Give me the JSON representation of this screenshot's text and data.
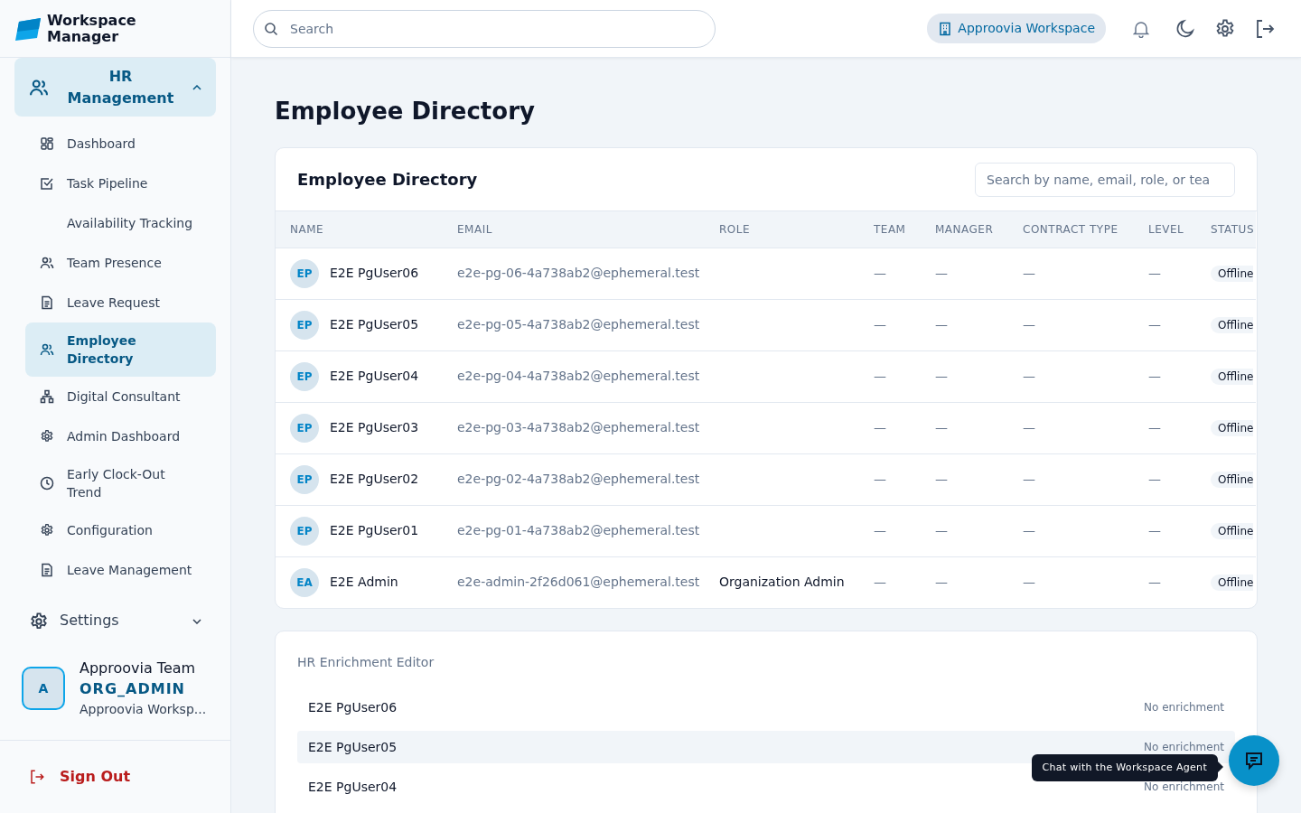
{
  "app": {
    "title": "Workspace Manager"
  },
  "header": {
    "search_placeholder": "Search",
    "workspace": "Approovia Workspace"
  },
  "sidebar": {
    "groups": [
      {
        "label": "HR Management",
        "expanded": true,
        "items": [
          {
            "label": "Dashboard",
            "selected": false
          },
          {
            "label": "Task Pipeline",
            "selected": false
          },
          {
            "label": "Availability Tracking",
            "selected": false
          },
          {
            "label": "Team Presence",
            "selected": false
          },
          {
            "label": "Leave Request",
            "selected": false
          },
          {
            "label": "Employee Directory",
            "selected": true
          },
          {
            "label": "Digital Consultant",
            "selected": false
          },
          {
            "label": "Admin Dashboard",
            "selected": false
          },
          {
            "label": "Early Clock-Out Trend",
            "selected": false
          },
          {
            "label": "Configuration",
            "selected": false
          },
          {
            "label": "Leave Management",
            "selected": false
          }
        ]
      },
      {
        "label": "Settings",
        "expanded": false
      }
    ],
    "user": {
      "initial": "A",
      "name": "Approovia Team",
      "role": "ORG_ADMIN",
      "workspace": "Approovia Worksp..."
    },
    "sign_out": "Sign Out"
  },
  "page": {
    "title": "Employee Directory"
  },
  "directory": {
    "title": "Employee Directory",
    "search_placeholder": "Search by name, email, role, or tea",
    "columns": [
      "NAME",
      "EMAIL",
      "ROLE",
      "TEAM",
      "MANAGER",
      "CONTRACT TYPE",
      "LEVEL",
      "STATUS"
    ],
    "rows": [
      {
        "initials": "EP",
        "name": "E2E PgUser06",
        "email": "e2e-pg-06-4a738ab2@ephemeral.test",
        "role": "",
        "team": "—",
        "manager": "—",
        "contract": "—",
        "level": "—",
        "status": "Offline"
      },
      {
        "initials": "EP",
        "name": "E2E PgUser05",
        "email": "e2e-pg-05-4a738ab2@ephemeral.test",
        "role": "",
        "team": "—",
        "manager": "—",
        "contract": "—",
        "level": "—",
        "status": "Offline"
      },
      {
        "initials": "EP",
        "name": "E2E PgUser04",
        "email": "e2e-pg-04-4a738ab2@ephemeral.test",
        "role": "",
        "team": "—",
        "manager": "—",
        "contract": "—",
        "level": "—",
        "status": "Offline"
      },
      {
        "initials": "EP",
        "name": "E2E PgUser03",
        "email": "e2e-pg-03-4a738ab2@ephemeral.test",
        "role": "",
        "team": "—",
        "manager": "—",
        "contract": "—",
        "level": "—",
        "status": "Offline"
      },
      {
        "initials": "EP",
        "name": "E2E PgUser02",
        "email": "e2e-pg-02-4a738ab2@ephemeral.test",
        "role": "",
        "team": "—",
        "manager": "—",
        "contract": "—",
        "level": "—",
        "status": "Offline"
      },
      {
        "initials": "EP",
        "name": "E2E PgUser01",
        "email": "e2e-pg-01-4a738ab2@ephemeral.test",
        "role": "",
        "team": "—",
        "manager": "—",
        "contract": "—",
        "level": "—",
        "status": "Offline"
      },
      {
        "initials": "EA",
        "name": "E2E Admin",
        "email": "e2e-admin-2f26d061@ephemeral.test",
        "role": "Organization Admin",
        "team": "—",
        "manager": "—",
        "contract": "—",
        "level": "—",
        "status": "Offline"
      }
    ]
  },
  "enrichment": {
    "title": "HR Enrichment Editor",
    "rows": [
      {
        "name": "E2E PgUser06",
        "note": "No enrichment",
        "selected": false
      },
      {
        "name": "E2E PgUser05",
        "note": "No enrichment",
        "selected": true
      },
      {
        "name": "E2E PgUser04",
        "note": "No enrichment",
        "selected": false
      }
    ]
  },
  "chat": {
    "tooltip": "Chat with the Workspace Agent"
  }
}
